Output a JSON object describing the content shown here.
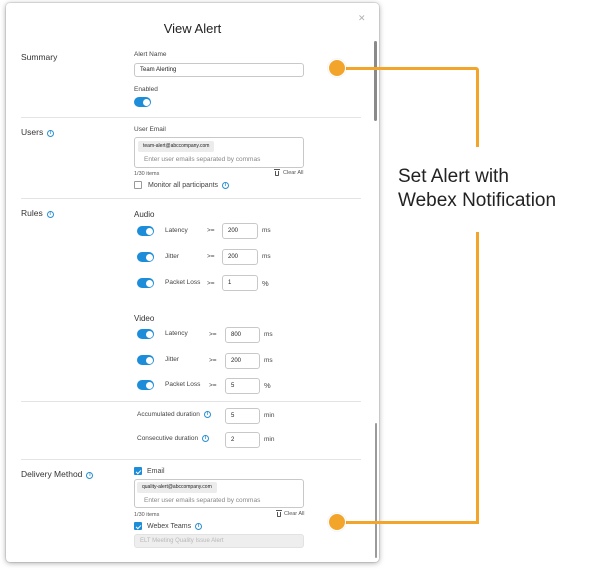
{
  "dialog": {
    "title": "View Alert"
  },
  "summary": {
    "section_label": "Summary",
    "alert_name_label": "Alert Name",
    "alert_name_value": "Team Alerting",
    "enabled_label": "Enabled",
    "enabled": true
  },
  "users": {
    "section_label": "Users",
    "email_label": "User Email",
    "email_chip": "team-alert@abccompany.com",
    "email_placeholder": "Enter user emails separated by commas",
    "count": "1/30 items",
    "clear_all": "Clear All",
    "monitor_label": "Monitor all participants",
    "monitor_checked": false
  },
  "rules": {
    "section_label": "Rules",
    "audio": {
      "heading": "Audio",
      "rows": [
        {
          "label": "Latency",
          "op": ">=",
          "value": "200",
          "unit": "ms"
        },
        {
          "label": "Jitter",
          "op": ">=",
          "value": "200",
          "unit": "ms"
        },
        {
          "label": "Packet Loss",
          "op": ">=",
          "value": "1",
          "unit": "%"
        }
      ]
    },
    "video": {
      "heading": "Video",
      "rows": [
        {
          "label": "Latency",
          "op": ">=",
          "value": "800",
          "unit": "ms"
        },
        {
          "label": "Jitter",
          "op": ">=",
          "value": "200",
          "unit": "ms"
        },
        {
          "label": "Packet Loss",
          "op": ">=",
          "value": "5",
          "unit": "%"
        }
      ]
    },
    "accumulated": {
      "label": "Accumulated duration",
      "value": "5",
      "unit": "min"
    },
    "consecutive": {
      "label": "Consecutive duration",
      "value": "2",
      "unit": "min"
    }
  },
  "delivery": {
    "section_label": "Delivery Method",
    "email_option": "Email",
    "email_checked": true,
    "email_chip": "quality-alert@abccompany.com",
    "email_placeholder": "Enter user emails separated by commas",
    "count": "1/30 items",
    "clear_all": "Clear All",
    "webex_option": "Webex Teams",
    "webex_checked": true,
    "webex_space_value": "ELT Meeting Quality Issue Alert"
  },
  "callout": {
    "line1": "Set Alert with",
    "line2": "Webex Notification",
    "accent_color": "#F3A52B"
  },
  "icons": {
    "close": "close-icon",
    "info": "info-icon",
    "trash": "trash-icon",
    "check": "checkmark-icon"
  }
}
